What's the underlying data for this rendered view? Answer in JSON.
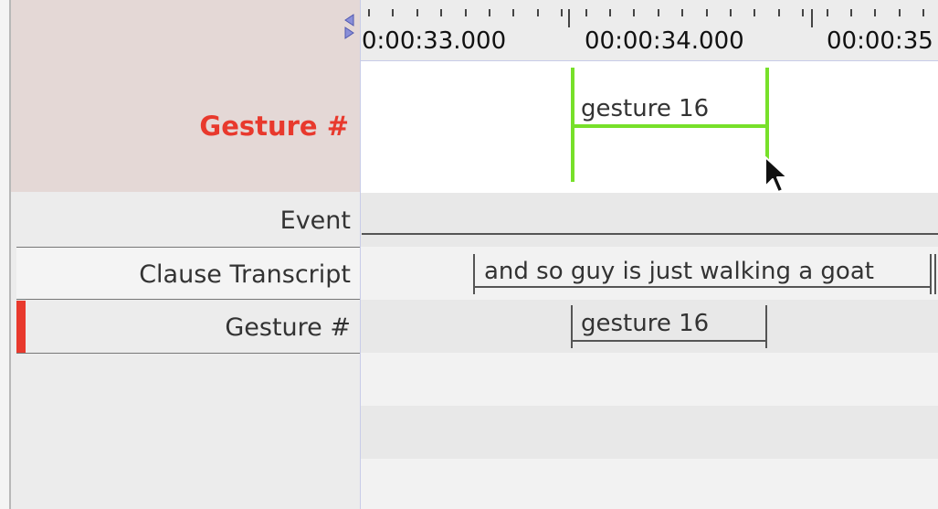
{
  "ruler": {
    "timecodes": [
      "0:00:33.000",
      "00:00:34.000",
      "00:00:35"
    ]
  },
  "focus_tier": {
    "label": "Gesture #",
    "annotation": "gesture 16",
    "highlight_color": "#e4d8d6",
    "label_color": "#e8392d",
    "segment_color": "#77e02a"
  },
  "tiers": [
    {
      "label": "Event"
    },
    {
      "label": "Clause Transcript",
      "annotation": "and so guy is just walking a goat"
    },
    {
      "label": "Gesture #",
      "annotation": "gesture 16",
      "active": true
    }
  ]
}
